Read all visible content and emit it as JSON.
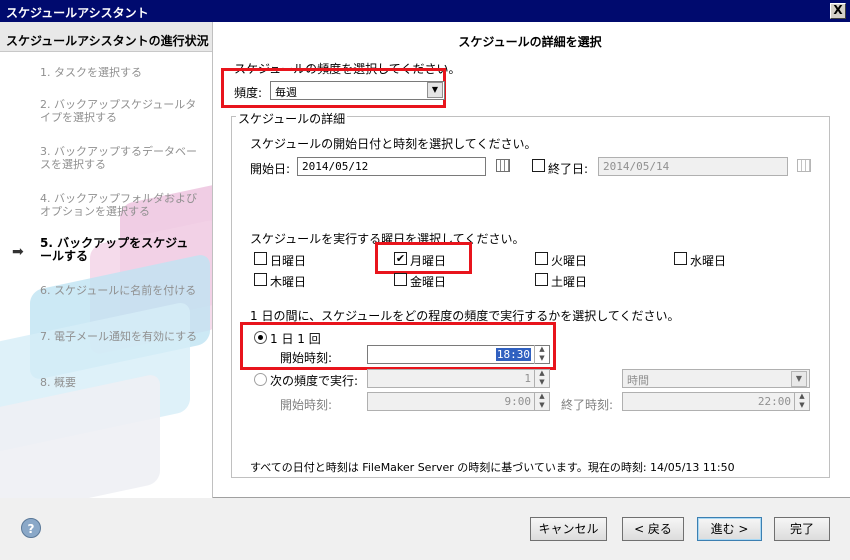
{
  "window": {
    "title": "スケジュールアシスタント",
    "close_glyph": "X"
  },
  "left_pane": {
    "header": "スケジュールアシスタントの進行状況",
    "steps": [
      {
        "label": "1. タスクを選択する"
      },
      {
        "label": "2. バックアップスケジュールタイプを選択する"
      },
      {
        "label": "3. バックアップするデータベースを選択する"
      },
      {
        "label": "4. バックアップフォルダおよびオプションを選択する"
      },
      {
        "label": "5. バックアップをスケジュールする"
      },
      {
        "label": "6. スケジュールに名前を付ける"
      },
      {
        "label": "7. 電子メール通知を有効にする"
      },
      {
        "label": "8. 概要"
      }
    ],
    "active_step": 5,
    "arrow_glyph": "➡"
  },
  "main": {
    "header": "スケジュールの詳細を選択",
    "frequency_prompt": "スケジュールの頻度を選択してください。",
    "frequency_label": "頻度:",
    "frequency_value": "毎週",
    "group_title": "スケジュールの詳細",
    "start_prompt": "スケジュールの開始日付と時刻を選択してください。",
    "start_date_label": "開始日:",
    "start_date_value": "2014/05/12",
    "end_date_label": "終了日:",
    "end_date_value": "2014/05/14",
    "end_date_checked": false,
    "days_prompt": "スケジュールを実行する曜日を選択してください。",
    "days": [
      {
        "label": "日曜日",
        "checked": false
      },
      {
        "label": "月曜日",
        "checked": true
      },
      {
        "label": "火曜日",
        "checked": false
      },
      {
        "label": "水曜日",
        "checked": false
      },
      {
        "label": "木曜日",
        "checked": false
      },
      {
        "label": "金曜日",
        "checked": false
      },
      {
        "label": "土曜日",
        "checked": false
      }
    ],
    "check_glyph": "✔",
    "interval_prompt": "1 日の間に、スケジュールをどの程度の頻度で実行するかを選択してください。",
    "once_option_label": "1 日 1 回",
    "once_option_selected": true,
    "once_start_time_label": "開始時刻:",
    "once_start_time_value": "18:30",
    "repeat_option_label": "次の頻度で実行:",
    "repeat_every_value": "1",
    "repeat_unit_value": "時間",
    "repeat_start_time_label": "開始時刻:",
    "repeat_start_time_value": "9:00",
    "repeat_end_time_label": "終了時刻:",
    "repeat_end_time_value": "22:00",
    "footnote": "すべての日付と時刻は FileMaker Server の時刻に基づいています。現在の時刻: 14/05/13 11:50"
  },
  "footer": {
    "help_glyph": "?",
    "cancel_label": "キャンセル",
    "back_label": "< 戻る",
    "next_label": "進む >",
    "finish_label": "完了"
  },
  "colors": {
    "titlebar": "#000a6e",
    "highlight": "#e8141c"
  }
}
